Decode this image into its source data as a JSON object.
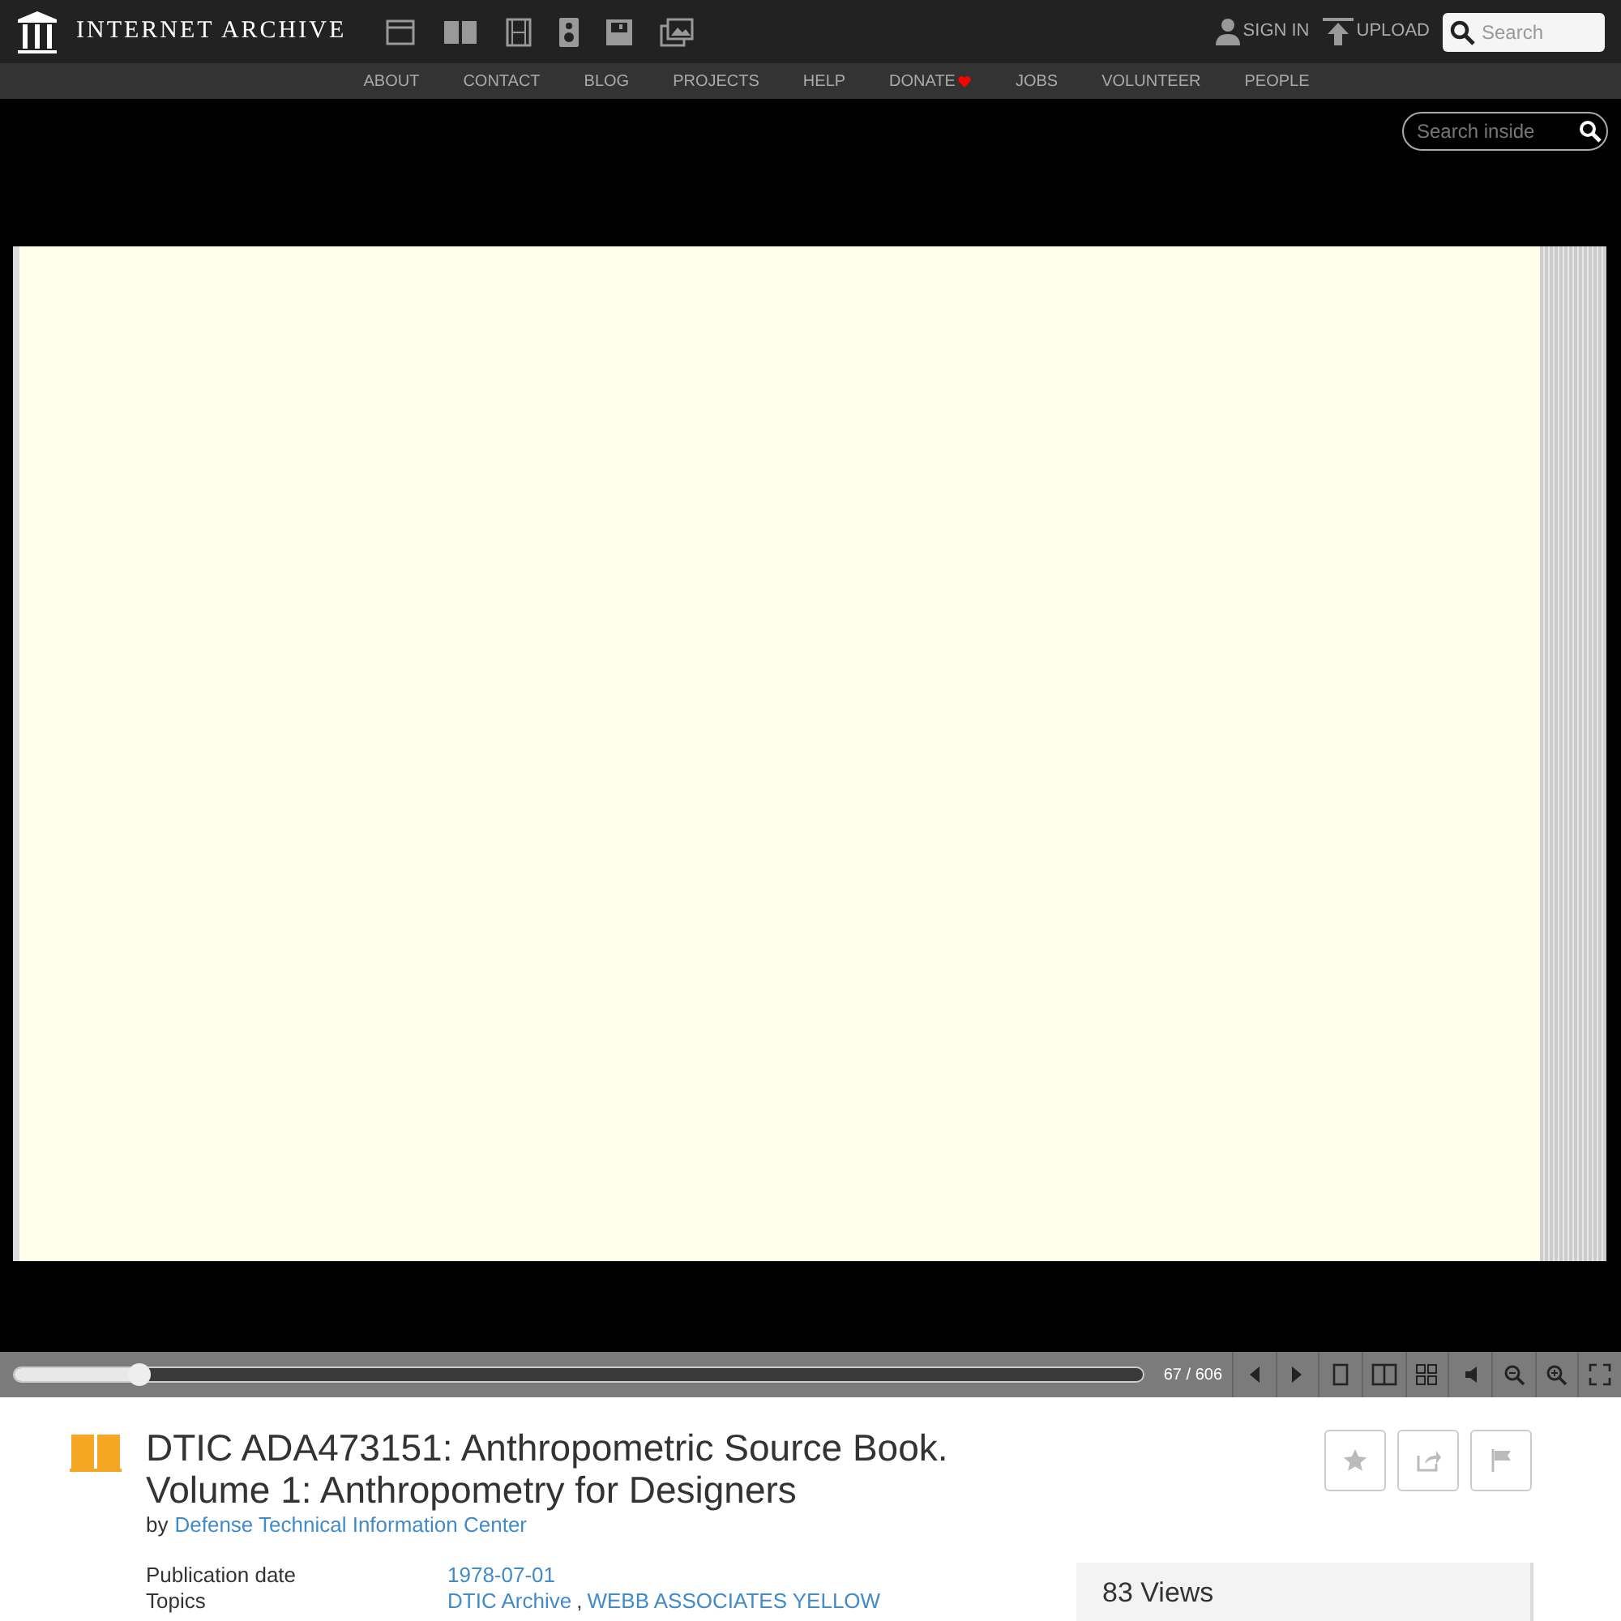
{
  "header": {
    "logo": "INTERNET ARCHIVE",
    "sign_in": "SIGN IN",
    "upload": "UPLOAD",
    "search": {
      "placeholder": "Search"
    }
  },
  "nav": [
    {
      "label": "ABOUT"
    },
    {
      "label": "CONTACT"
    },
    {
      "label": "BLOG"
    },
    {
      "label": "PROJECTS"
    },
    {
      "label": "HELP"
    },
    {
      "label": "DONATE",
      "heart": true
    },
    {
      "label": "JOBS"
    },
    {
      "label": "VOLUNTEER"
    },
    {
      "label": "PEOPLE"
    }
  ],
  "reader": {
    "search_inside": {
      "placeholder": "Search inside"
    },
    "progress": {
      "level": 0.11
    },
    "page_count": "67 / 606"
  },
  "item": {
    "title_lines": [
      "DTIC ADA473151: Anthropometric Source Book.",
      "Volume 1: Anthropometry for Designers"
    ],
    "by": "by",
    "author": "Defense Technical Information Center",
    "metadata": [
      {
        "label": "Publication date",
        "values": [
          "1978-07-01"
        ]
      },
      {
        "label": "Topics",
        "values": [
          "DTIC Archive",
          "WEBB ASSOCIATES YELLOW"
        ],
        "separator": ","
      }
    ],
    "views": "83 Views"
  }
}
